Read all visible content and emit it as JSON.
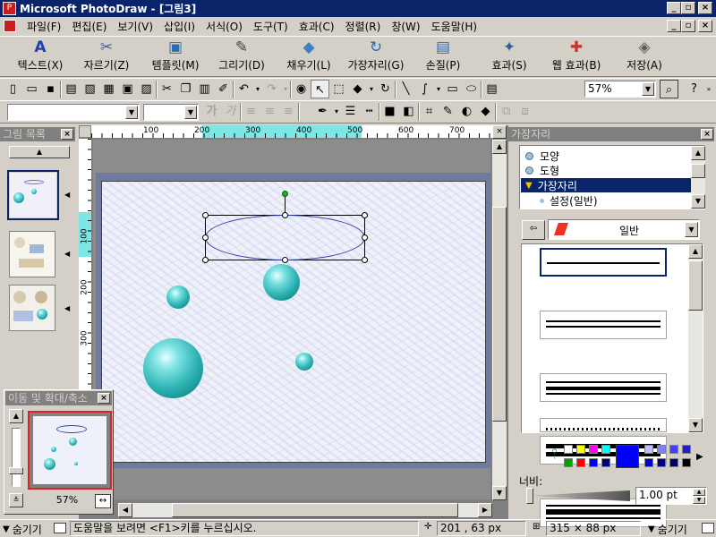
{
  "window": {
    "title": "Microsoft PhotoDraw - [그림3]",
    "app_icon": "photodraw-icon"
  },
  "menu": [
    "파일(F)",
    "편집(E)",
    "보기(V)",
    "삽입(I)",
    "서식(O)",
    "도구(T)",
    "효과(C)",
    "정렬(R)",
    "창(W)",
    "도움말(H)"
  ],
  "big_toolbar": [
    {
      "label": "텍스트(X)",
      "icon": "text-A-icon"
    },
    {
      "label": "자르기(Z)",
      "icon": "scissors-icon"
    },
    {
      "label": "템플릿(M)",
      "icon": "template-icon"
    },
    {
      "label": "그리기(D)",
      "icon": "draw-icon"
    },
    {
      "label": "채우기(L)",
      "icon": "fill-bucket-icon"
    },
    {
      "label": "가장자리(G)",
      "icon": "edge-icon"
    },
    {
      "label": "손질(P)",
      "icon": "touchup-icon"
    },
    {
      "label": "효과(S)",
      "icon": "effects-icon"
    },
    {
      "label": "웹 효과(B)",
      "icon": "web-effects-icon"
    },
    {
      "label": "저장(A)",
      "icon": "save-icon"
    }
  ],
  "standard_toolbar": {
    "zoom": "57%"
  },
  "format_toolbar": {
    "font": "",
    "size": ""
  },
  "picture_list": {
    "title": "그림 목록"
  },
  "ruler": {
    "h_ticks": [
      "100",
      "200",
      "300",
      "400",
      "500",
      "600",
      "700"
    ],
    "v_ticks": [
      "100",
      "200",
      "300"
    ]
  },
  "pan_zoom": {
    "title": "이동 및 확대/축소",
    "zoom": "57%"
  },
  "edge_panel": {
    "title": "가장자리",
    "tree": [
      "모양",
      "도형",
      "가장자리",
      "설정(일반)"
    ],
    "selected_tree": "가장자리",
    "category": "일반",
    "width_label": "너비:",
    "width_value": "1.00 pt"
  },
  "status": {
    "hide_left": "숨기기",
    "help": "도움말을 보려면 <F1>키를 누르십시오.",
    "position": "201 , 63  px",
    "size": "315 × 88  px",
    "hide_right": "숨기기"
  },
  "colors": {
    "sphere": "#2ab1b1",
    "selected_swatch": "#0000ff",
    "titlebar": "#0a246a"
  }
}
